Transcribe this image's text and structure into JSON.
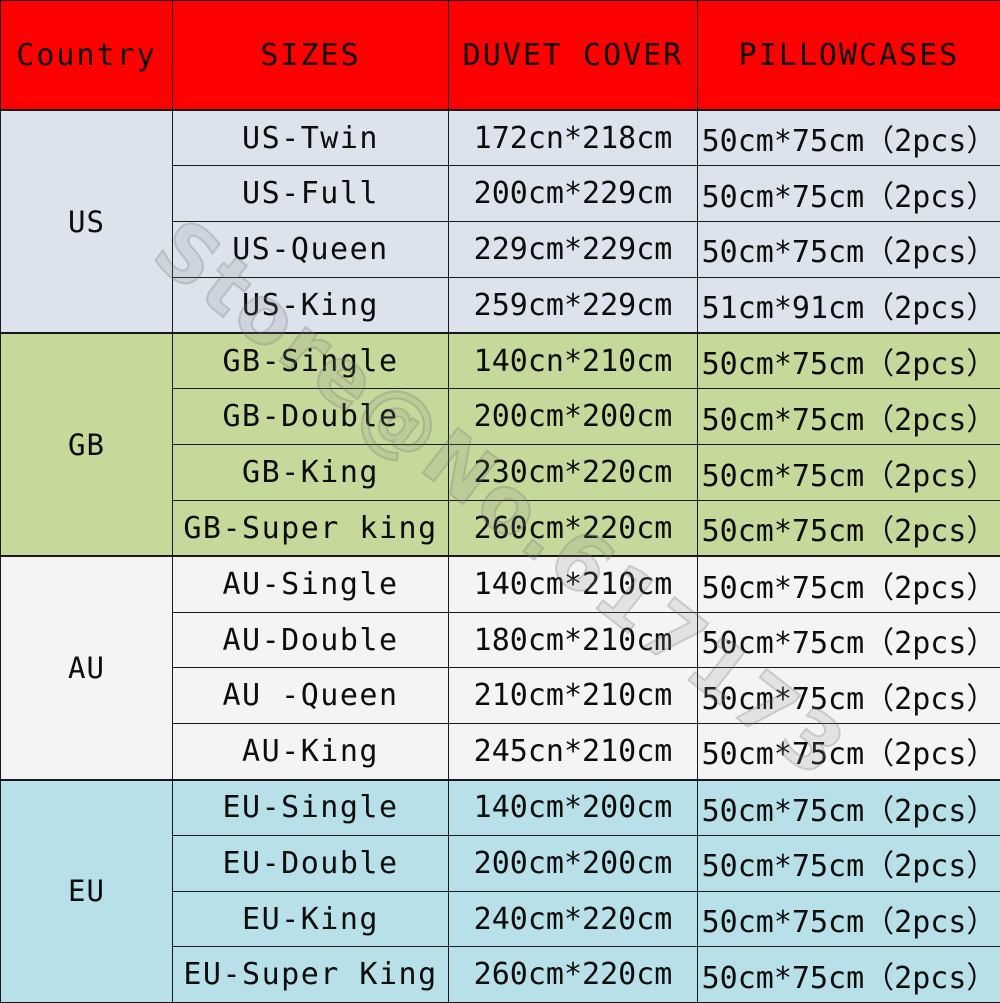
{
  "table": {
    "headers": [
      {
        "key": "country",
        "label": "Country"
      },
      {
        "key": "sizes",
        "label": "SIZES"
      },
      {
        "key": "duvet",
        "label": "DUVET COVER"
      },
      {
        "key": "pillow",
        "label": "PILLOWCASES"
      }
    ],
    "groups": [
      {
        "country": "US",
        "bg": "#dce3ed",
        "rows": [
          {
            "size": "US-Twin",
            "duvet": "172cn*218cm",
            "pillow": "50cm*75cm（2pcs）"
          },
          {
            "size": "US-Full",
            "duvet": "200cm*229cm",
            "pillow": "50cm*75cm（2pcs）"
          },
          {
            "size": "US-Queen",
            "duvet": "229cm*229cm",
            "pillow": "50cm*75cm（2pcs）"
          },
          {
            "size": "US-King",
            "duvet": "259cm*229cm",
            "pillow": "51cm*91cm（2pcs）"
          }
        ]
      },
      {
        "country": "GB",
        "bg": "#c5d99a",
        "rows": [
          {
            "size": "GB-Single",
            "duvet": "140cn*210cm",
            "pillow": "50cm*75cm（2pcs）"
          },
          {
            "size": "GB-Double",
            "duvet": "200cm*200cm",
            "pillow": "50cm*75cm（2pcs）"
          },
          {
            "size": "GB-King",
            "duvet": "230cm*220cm",
            "pillow": "50cm*75cm（2pcs）"
          },
          {
            "size": "GB-Super king",
            "duvet": "260cm*220cm",
            "pillow": "50cm*75cm（2pcs）"
          }
        ]
      },
      {
        "country": "AU",
        "bg": "#f4f4f4",
        "rows": [
          {
            "size": "AU-Single",
            "duvet": "140cm*210cm",
            "pillow": "50cm*75cm（2pcs）"
          },
          {
            "size": "AU-Double",
            "duvet": "180cm*210cm",
            "pillow": "50cm*75cm（2pcs）"
          },
          {
            "size": "AU -Queen",
            "duvet": "210cm*210cm",
            "pillow": "50cm*75cm（2pcs）"
          },
          {
            "size": "AU-King",
            "duvet": "245cn*210cm",
            "pillow": "50cm*75cm（2pcs）"
          }
        ]
      },
      {
        "country": "EU",
        "bg": "#b8e0e8",
        "rows": [
          {
            "size": "EU-Single",
            "duvet": "140cm*200cm",
            "pillow": "50cm*75cm（2pcs）"
          },
          {
            "size": "EU-Double",
            "duvet": "200cm*200cm",
            "pillow": "50cm*75cm（2pcs）"
          },
          {
            "size": "EU-King",
            "duvet": "240cm*220cm",
            "pillow": "50cm*75cm（2pcs）"
          },
          {
            "size": "EU-Super King",
            "duvet": "260cm*220cm",
            "pillow": "50cm*75cm（2pcs）"
          }
        ]
      }
    ]
  },
  "style": {
    "header_bg": "#ff0000",
    "header_text_color": "#0d0d0d",
    "border_color": "#1a1a1a",
    "body_text_color": "#0d0d0d"
  },
  "watermark": {
    "text": "Store@No.617173"
  }
}
